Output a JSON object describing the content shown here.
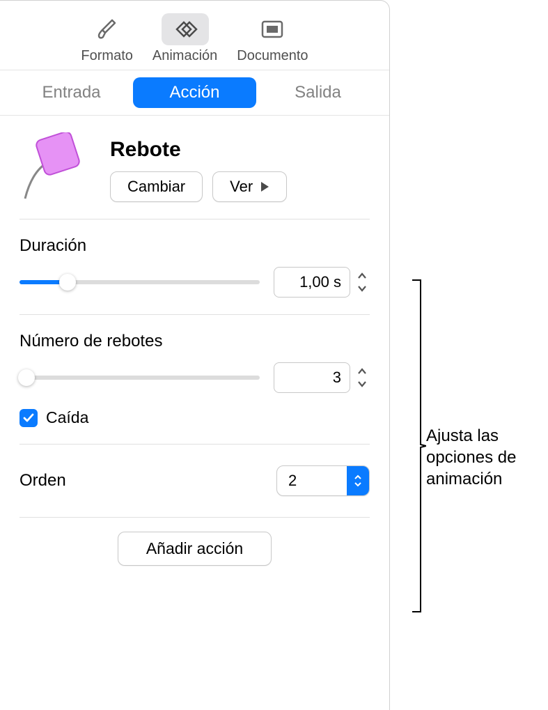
{
  "toolbar": {
    "format": "Formato",
    "animation": "Animación",
    "document": "Documento"
  },
  "tabs": {
    "in": "Entrada",
    "action": "Acción",
    "out": "Salida"
  },
  "effect": {
    "name": "Rebote",
    "change": "Cambiar",
    "preview": "Ver"
  },
  "duration": {
    "label": "Duración",
    "value": "1,00 s",
    "slider_pct": 20
  },
  "bounces": {
    "label": "Número de rebotes",
    "value": "3",
    "slider_pct": 3
  },
  "fall": {
    "label": "Caída",
    "checked": true
  },
  "order": {
    "label": "Orden",
    "value": "2"
  },
  "footer": {
    "add": "Añadir acción"
  },
  "callout": "Ajusta las opciones de animación"
}
